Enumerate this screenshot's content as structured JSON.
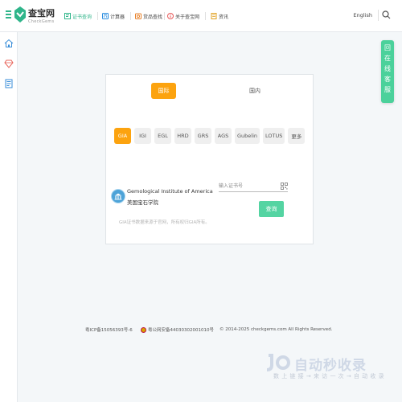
{
  "header": {
    "brand": "查宝网",
    "brand_sub": "CheckGems",
    "nav": [
      {
        "label": "证书查询",
        "icon": "certificate-icon",
        "active": true
      },
      {
        "label": "计算器",
        "icon": "calculator-icon",
        "active": false
      },
      {
        "label": "货品查找",
        "icon": "product-search-icon",
        "active": false
      },
      {
        "label": "关于查宝网",
        "icon": "about-icon",
        "active": false
      },
      {
        "label": "资讯",
        "icon": "news-icon",
        "active": false
      }
    ],
    "lang": "English"
  },
  "tabs": [
    {
      "label": "国际",
      "active": true
    },
    {
      "label": "国内",
      "active": false
    }
  ],
  "labs": [
    "GIA",
    "IGI",
    "EGL",
    "HRD",
    "GRS",
    "AGS",
    "Gubelin",
    "LOTUS",
    "更多"
  ],
  "selected_lab": "GIA",
  "institute": {
    "name_en": "Gemological Institute of America",
    "name_cn": "美国宝石学院"
  },
  "search": {
    "placeholder": "输入证书号",
    "value": "",
    "button": "查询"
  },
  "note": "GIA证书数据来源于官网，所有权归GIA所有。",
  "float_service": [
    "回",
    "在",
    "线",
    "客",
    "服"
  ],
  "footer": {
    "icp": "粤ICP备15056393号-6",
    "police": "粤公网安备44030302001010号",
    "copyright": "© 2014-2025 checkgems.com All Rights Reserved."
  },
  "watermark": {
    "title": "自动秒收录",
    "subtitle": "数 上 链 接 → 来 访 一 次 → 自 动 收 录"
  },
  "colors": {
    "accent_green": "#2fb58a",
    "active_orange": "#fca30f",
    "button_green": "#54d4a2"
  }
}
